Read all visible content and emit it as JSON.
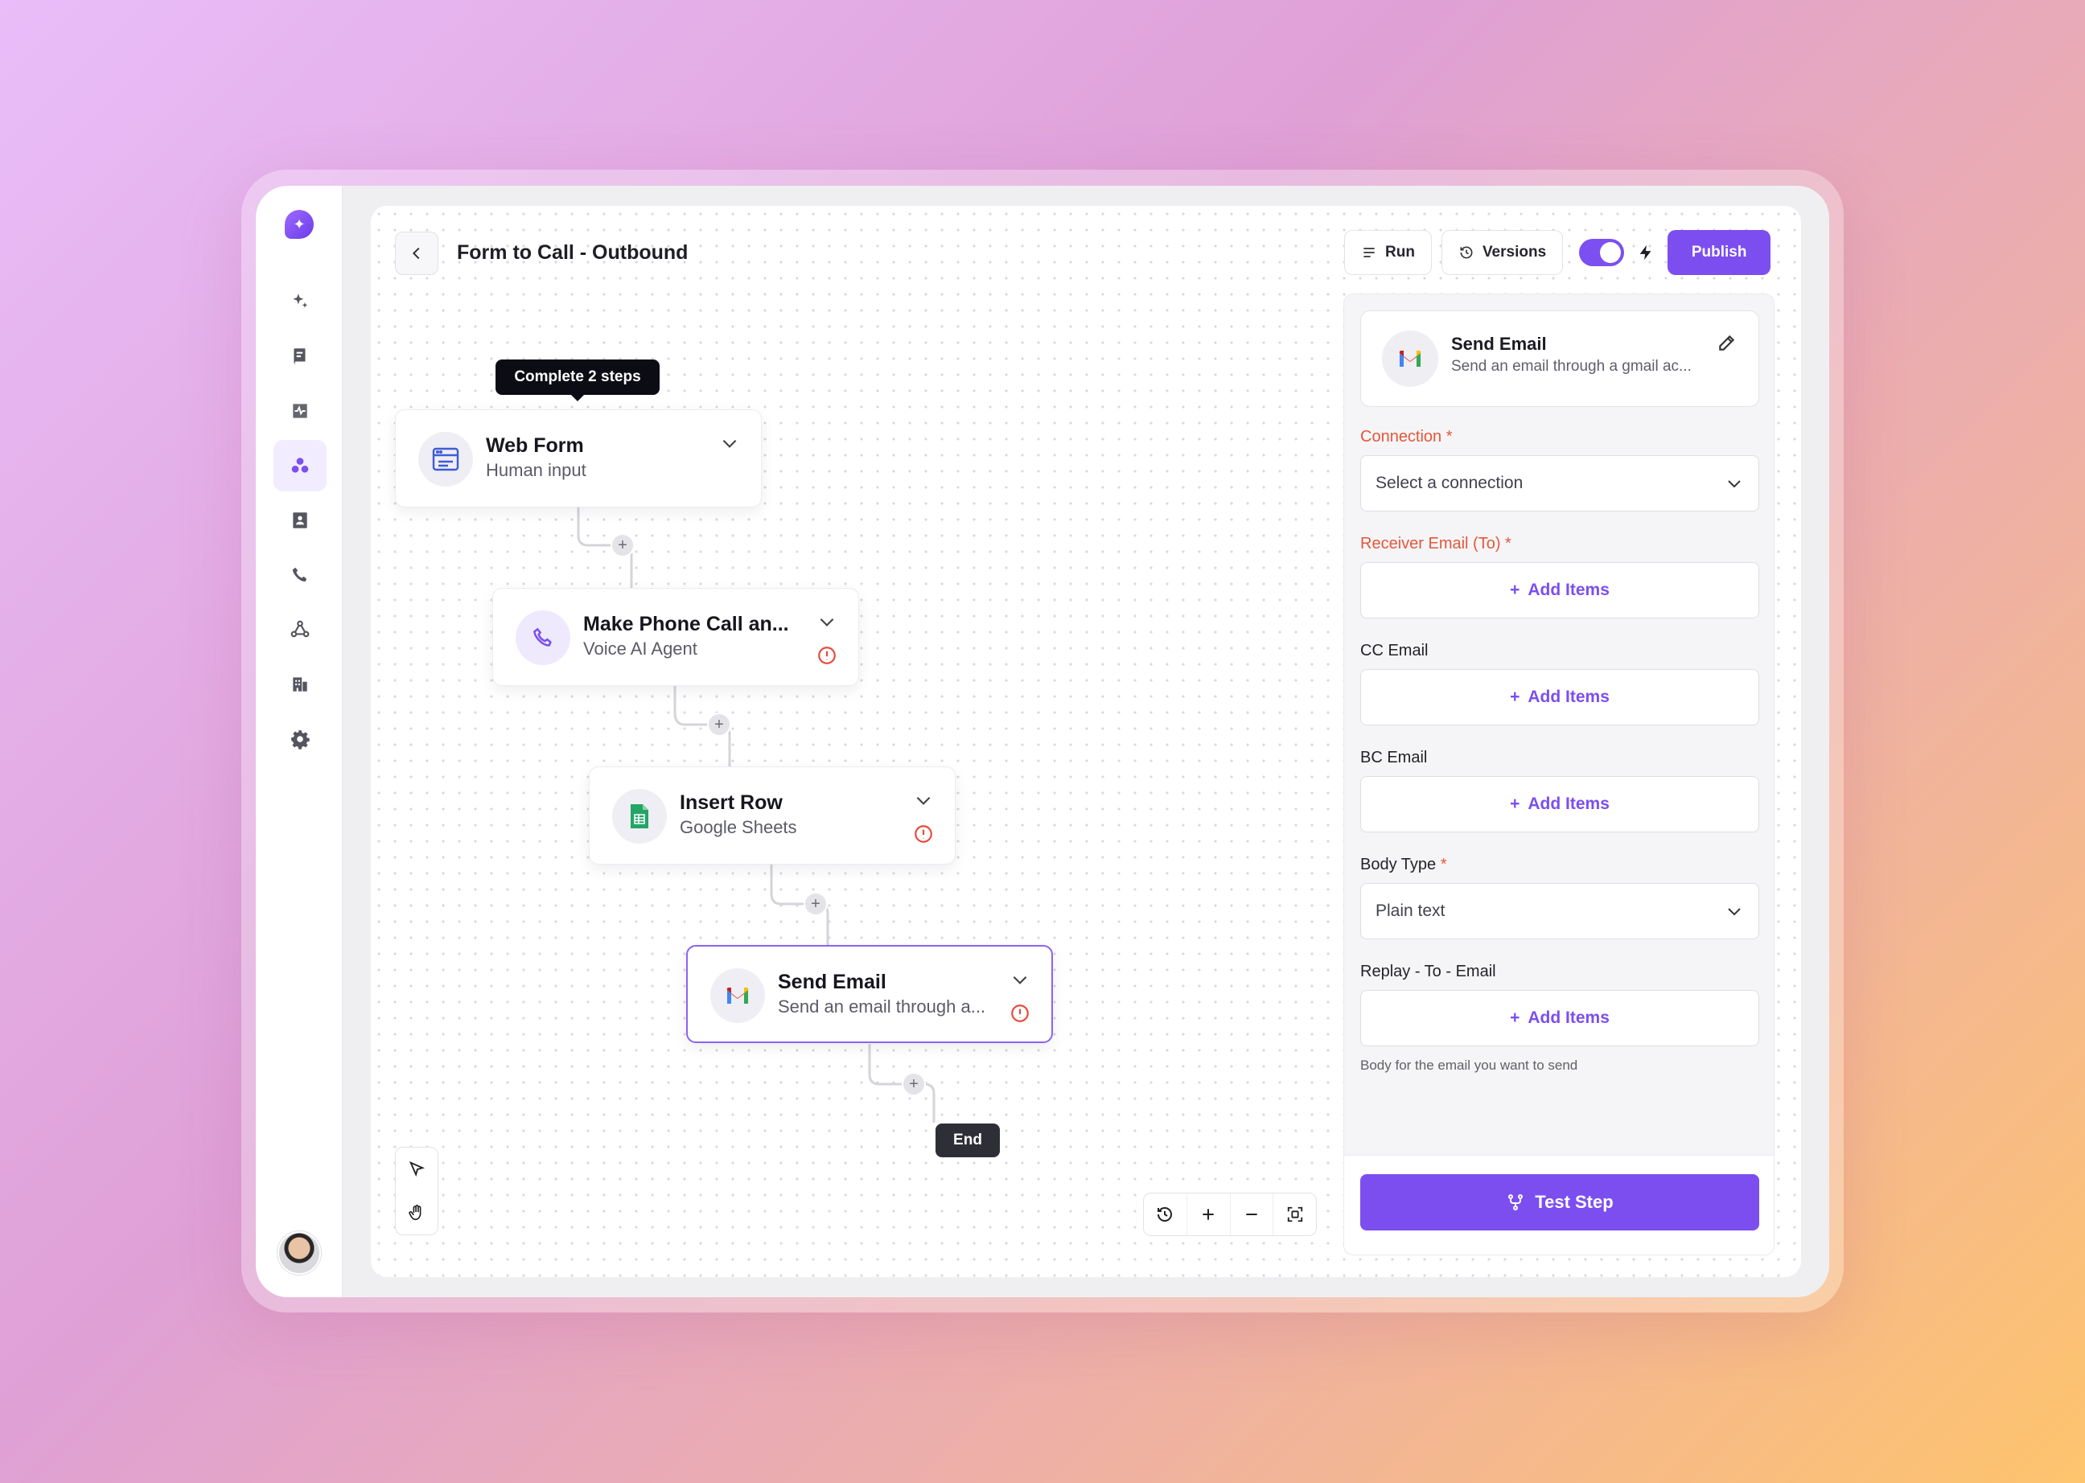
{
  "app": {
    "title": "Form to Call - Outbound",
    "accent_color": "#7c4ef0"
  },
  "sidebar": {
    "logo": "sparkle-logo",
    "items": [
      {
        "icon": "sparkles-icon",
        "active": false
      },
      {
        "icon": "book-icon",
        "active": false
      },
      {
        "icon": "activity-icon",
        "active": false
      },
      {
        "icon": "workflow-icon",
        "active": true
      },
      {
        "icon": "contacts-icon",
        "active": false
      },
      {
        "icon": "phone-icon",
        "active": false
      },
      {
        "icon": "integrations-icon",
        "active": false
      },
      {
        "icon": "building-icon",
        "active": false
      },
      {
        "icon": "gear-icon",
        "active": false
      }
    ]
  },
  "toolbar": {
    "run_label": "Run",
    "versions_label": "Versions",
    "toggle_on": true,
    "publish_label": "Publish"
  },
  "flow": {
    "tooltip": "Complete 2 steps",
    "nodes": [
      {
        "title": "Web Form",
        "subtitle": "Human input",
        "icon": "browser-window-icon",
        "warning": false
      },
      {
        "title": "Make Phone Call an...",
        "subtitle": "Voice AI Agent",
        "icon": "phone-icon",
        "warning": true
      },
      {
        "title": "Insert Row",
        "subtitle": "Google Sheets",
        "icon": "google-sheets-icon",
        "warning": true
      },
      {
        "title": "Send Email",
        "subtitle": "Send an email through a...",
        "icon": "gmail-icon",
        "warning": true,
        "selected": true
      }
    ],
    "add_step_symbol": "+",
    "end_label": "End"
  },
  "canvas_tools": {
    "pointer": "cursor-icon",
    "hand": "hand-icon",
    "zoom_controls": [
      "history-icon",
      "zoom-in-icon",
      "zoom-out-icon",
      "fit-screen-icon"
    ]
  },
  "panel": {
    "step": {
      "title": "Send Email",
      "subtitle": "Send an email through a gmail ac..."
    },
    "connection": {
      "label": "Connection",
      "required": true,
      "placeholder": "Select a connection"
    },
    "receiver": {
      "label": "Receiver Email (To)",
      "required": true,
      "add_label": "Add Items"
    },
    "cc": {
      "label": "CC Email",
      "add_label": "Add Items"
    },
    "bc": {
      "label": "BC Email",
      "add_label": "Add Items"
    },
    "body_type": {
      "label": "Body Type",
      "required": true,
      "value": "Plain text"
    },
    "reply_to": {
      "label": "Replay - To - Email",
      "add_label": "Add Items"
    },
    "hint": "Body for the email you want to send",
    "test_button": "Test Step"
  }
}
